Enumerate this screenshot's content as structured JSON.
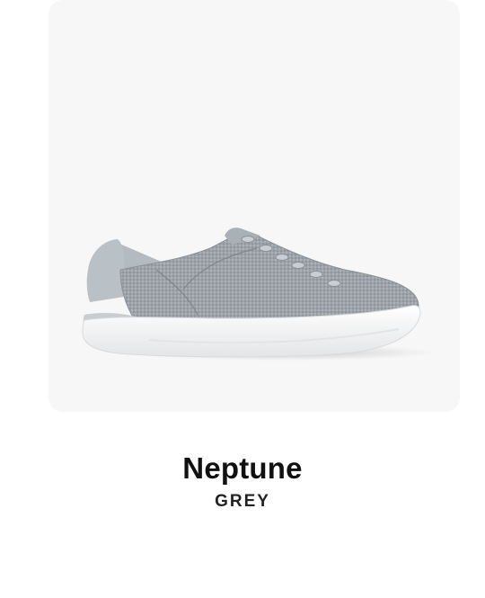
{
  "product": {
    "name": "Neptune",
    "color_name": "GREY",
    "image_icon": "sneaker-image"
  },
  "colors": {
    "panel_background": "#f7f7f7",
    "knit_upper": "#9ea5ab",
    "sole": "#f4f4f5",
    "heel_tab": "#b9c0c6",
    "title_text": "#111111"
  }
}
